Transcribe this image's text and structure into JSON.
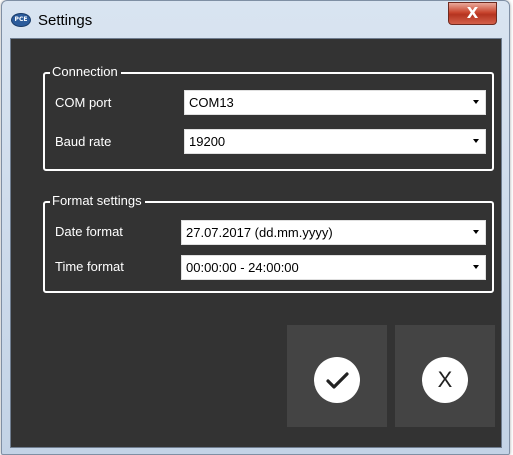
{
  "window": {
    "title": "Settings",
    "icon_text": "PCE",
    "close_glyph": "X"
  },
  "connection": {
    "title": "Connection",
    "com_port": {
      "label": "COM port",
      "value": "COM13"
    },
    "baud_rate": {
      "label": "Baud rate",
      "value": "19200"
    }
  },
  "format_settings": {
    "title": "Format settings",
    "date_format": {
      "label": "Date format",
      "value": "27.07.2017 (dd.mm.yyyy)"
    },
    "time_format": {
      "label": "Time format",
      "value": "00:00:00 - 24:00:00"
    }
  },
  "buttons": {
    "ok_icon": "checkmark-icon",
    "cancel_glyph": "X"
  },
  "colors": {
    "client_background": "#333333",
    "button_background": "#444444",
    "group_border": "#ffffff",
    "close_button": "#c9452e"
  }
}
